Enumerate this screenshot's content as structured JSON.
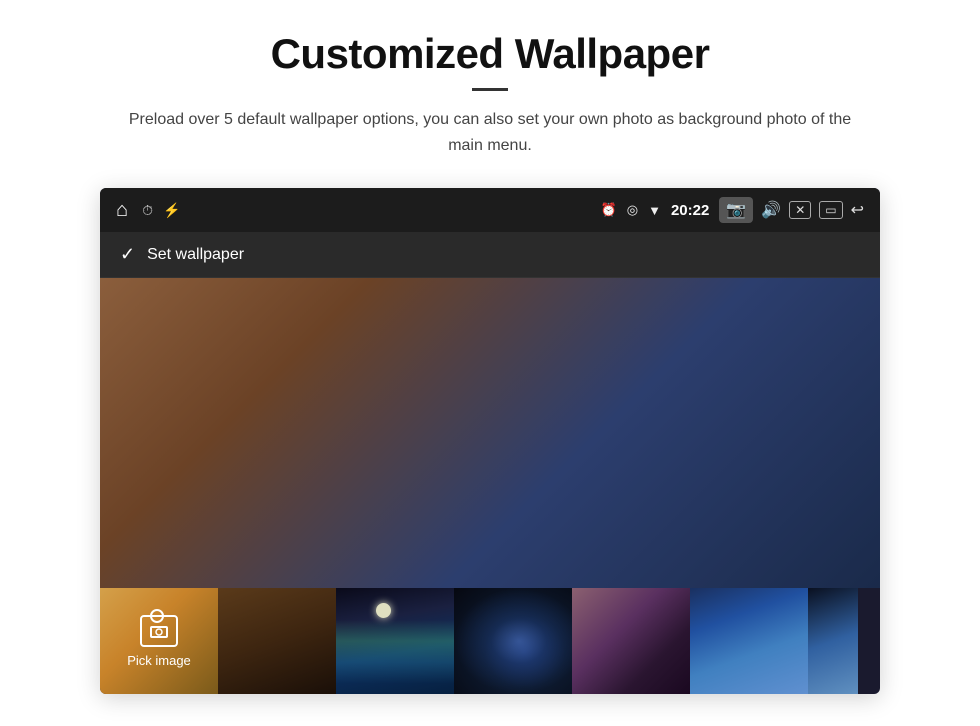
{
  "header": {
    "title": "Customized Wallpaper",
    "divider": true,
    "subtitle": "Preload over 5 default wallpaper options, you can also set your own photo as background photo of the main menu."
  },
  "device": {
    "status_bar": {
      "time": "20:22",
      "icons_left": [
        "⌂",
        "⏰",
        "⚡"
      ],
      "icons_right": [
        "⏰",
        "◎",
        "▼",
        "📷",
        "🔊",
        "✕",
        "▭",
        "↩"
      ]
    },
    "action_bar": {
      "check_label": "✓",
      "label": "Set wallpaper"
    },
    "thumbnail_strip": {
      "pick_image_label": "Pick image",
      "thumbnails_count": 6
    }
  }
}
